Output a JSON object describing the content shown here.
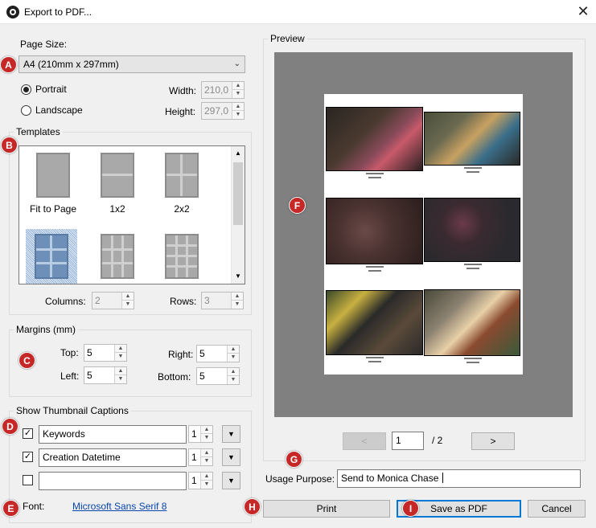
{
  "window": {
    "title": "Export to PDF...",
    "close_glyph": "✕"
  },
  "page_size": {
    "label": "Page Size:",
    "selected": "A4 (210mm x 297mm)",
    "orientation": {
      "portrait": "Portrait",
      "landscape": "Landscape",
      "selected": "portrait"
    },
    "width_label": "Width:",
    "width_value": "210,0",
    "height_label": "Height:",
    "height_value": "297,0"
  },
  "templates": {
    "label": "Templates",
    "items": [
      {
        "label": "Fit to Page"
      },
      {
        "label": "1x2"
      },
      {
        "label": "2x2"
      },
      {
        "label": ""
      },
      {
        "label": ""
      },
      {
        "label": ""
      }
    ],
    "columns_label": "Columns:",
    "columns_value": "2",
    "rows_label": "Rows:",
    "rows_value": "3"
  },
  "margins": {
    "label": "Margins (mm)",
    "top_label": "Top:",
    "top_value": "5",
    "left_label": "Left:",
    "left_value": "5",
    "right_label": "Right:",
    "right_value": "5",
    "bottom_label": "Bottom:",
    "bottom_value": "5"
  },
  "captions": {
    "label": "Show Thumbnail Captions",
    "rows": [
      {
        "checked": "✓",
        "field": "Keywords",
        "lines": "1"
      },
      {
        "checked": "✓",
        "field": "Creation Datetime",
        "lines": "1"
      },
      {
        "checked": "",
        "field": "",
        "lines": "1"
      }
    ],
    "font_label": "Font:",
    "font_value": "Microsoft Sans Serif 8"
  },
  "preview": {
    "label": "Preview",
    "prev_label": "<",
    "next_label": ">",
    "page_value": "1",
    "page_total": "/ 2"
  },
  "usage": {
    "label": "Usage Purpose:",
    "value": "Send to Monica Chase"
  },
  "buttons": {
    "print": "Print",
    "save": "Save as PDF",
    "cancel": "Cancel"
  },
  "markers": {
    "a": "A",
    "b": "B",
    "c": "C",
    "d": "D",
    "e": "E",
    "f": "F",
    "g": "G",
    "h": "H",
    "i": "I"
  },
  "colors": {
    "marker": "#c62828",
    "preview_bg": "#808080",
    "primary_border": "#0078d7",
    "link": "#0645ad"
  }
}
